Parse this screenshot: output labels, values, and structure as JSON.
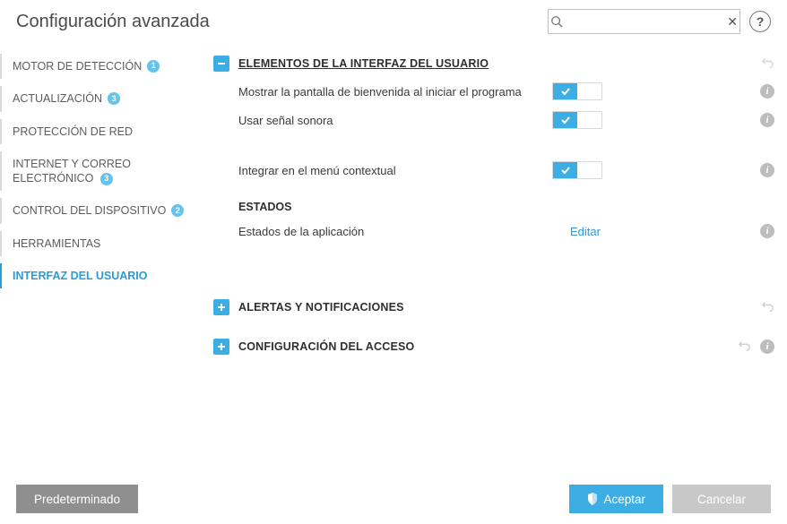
{
  "header": {
    "title": "Configuración avanzada",
    "search_placeholder": ""
  },
  "sidebar": {
    "items": [
      {
        "label": "MOTOR DE DETECCIÓN",
        "badge": "1"
      },
      {
        "label": "ACTUALIZACIÓN",
        "badge": "3"
      },
      {
        "label": "PROTECCIÓN DE RED",
        "badge": ""
      },
      {
        "label": "INTERNET Y CORREO ELECTRÓNICO",
        "badge": "3"
      },
      {
        "label": "CONTROL DEL DISPOSITIVO",
        "badge": "2"
      },
      {
        "label": "HERRAMIENTAS",
        "badge": ""
      },
      {
        "label": "INTERFAZ DEL USUARIO",
        "badge": ""
      }
    ]
  },
  "sections": {
    "ui": {
      "title": "ELEMENTOS DE LA INTERFAZ DEL USUARIO",
      "rows": {
        "splash": "Mostrar la pantalla de bienvenida al iniciar el programa",
        "sound": "Usar señal sonora",
        "context": "Integrar en el menú contextual"
      },
      "states_heading": "ESTADOS",
      "states_row": "Estados de la aplicación",
      "states_action": "Editar"
    },
    "alerts": {
      "title": "ALERTAS Y NOTIFICACIONES"
    },
    "access": {
      "title": "CONFIGURACIÓN DEL ACCESO"
    }
  },
  "footer": {
    "default": "Predeterminado",
    "ok": "Aceptar",
    "cancel": "Cancelar"
  },
  "icons": {
    "expand_minus": "–",
    "expand_plus": "+",
    "info": "i",
    "clear": "✕",
    "help": "?"
  }
}
